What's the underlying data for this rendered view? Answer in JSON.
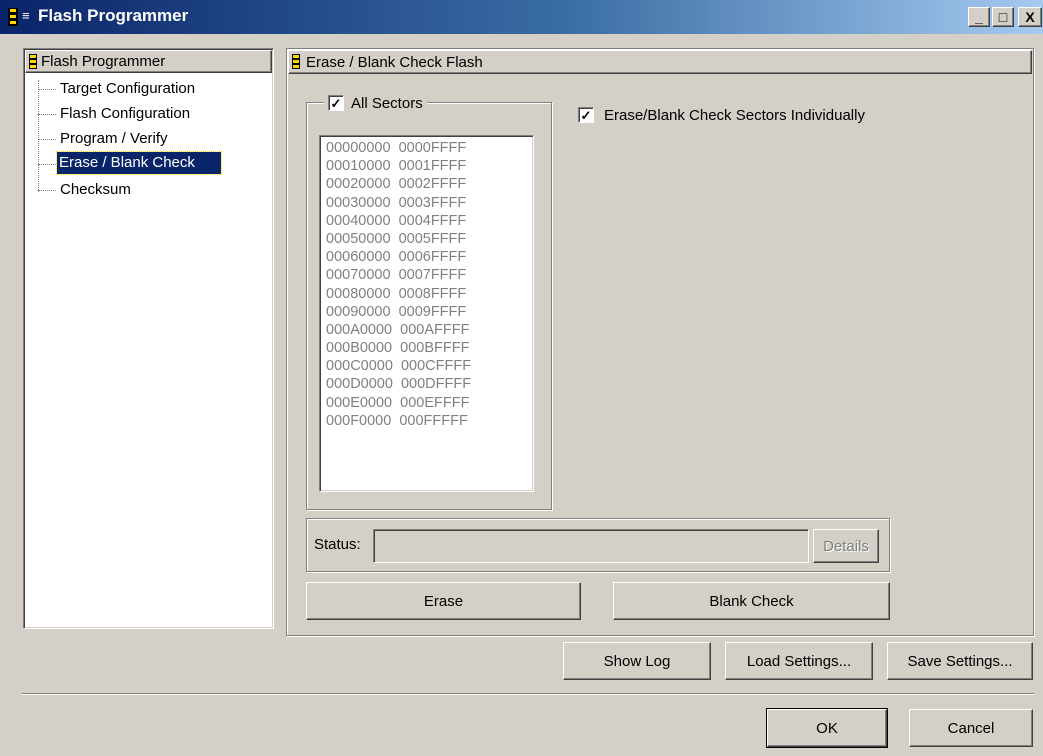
{
  "window": {
    "title": "Flash Programmer",
    "min_label": "_",
    "max_label": "□",
    "close_label": "X"
  },
  "tree": {
    "root": "Flash Programmer",
    "items": [
      {
        "label": "Target Configuration"
      },
      {
        "label": "Flash Configuration"
      },
      {
        "label": "Program / Verify"
      },
      {
        "label": "Erase / Blank Check",
        "selected": true
      },
      {
        "label": "Checksum"
      }
    ]
  },
  "panel": {
    "title": "Erase / Blank Check Flash",
    "all_sectors_label": "All Sectors",
    "all_sectors_checked": true,
    "individual_label": "Erase/Blank Check Sectors Individually",
    "individual_checked": true,
    "sectors": [
      "00000000  0000FFFF",
      "00010000  0001FFFF",
      "00020000  0002FFFF",
      "00030000  0003FFFF",
      "00040000  0004FFFF",
      "00050000  0005FFFF",
      "00060000  0006FFFF",
      "00070000  0007FFFF",
      "00080000  0008FFFF",
      "00090000  0009FFFF",
      "000A0000  000AFFFF",
      "000B0000  000BFFFF",
      "000C0000  000CFFFF",
      "000D0000  000DFFFF",
      "000E0000  000EFFFF",
      "000F0000  000FFFFF"
    ],
    "status_label": "Status:",
    "status_value": "",
    "details_label": "Details",
    "erase_label": "Erase",
    "blank_check_label": "Blank Check"
  },
  "footer": {
    "show_log": "Show Log",
    "load_settings": "Load Settings...",
    "save_settings": "Save Settings...",
    "ok": "OK",
    "cancel": "Cancel"
  },
  "colors": {
    "selection": "#0a246a",
    "face": "#d4d0c8",
    "title_start": "#0a246a",
    "title_end": "#a6caf0"
  }
}
